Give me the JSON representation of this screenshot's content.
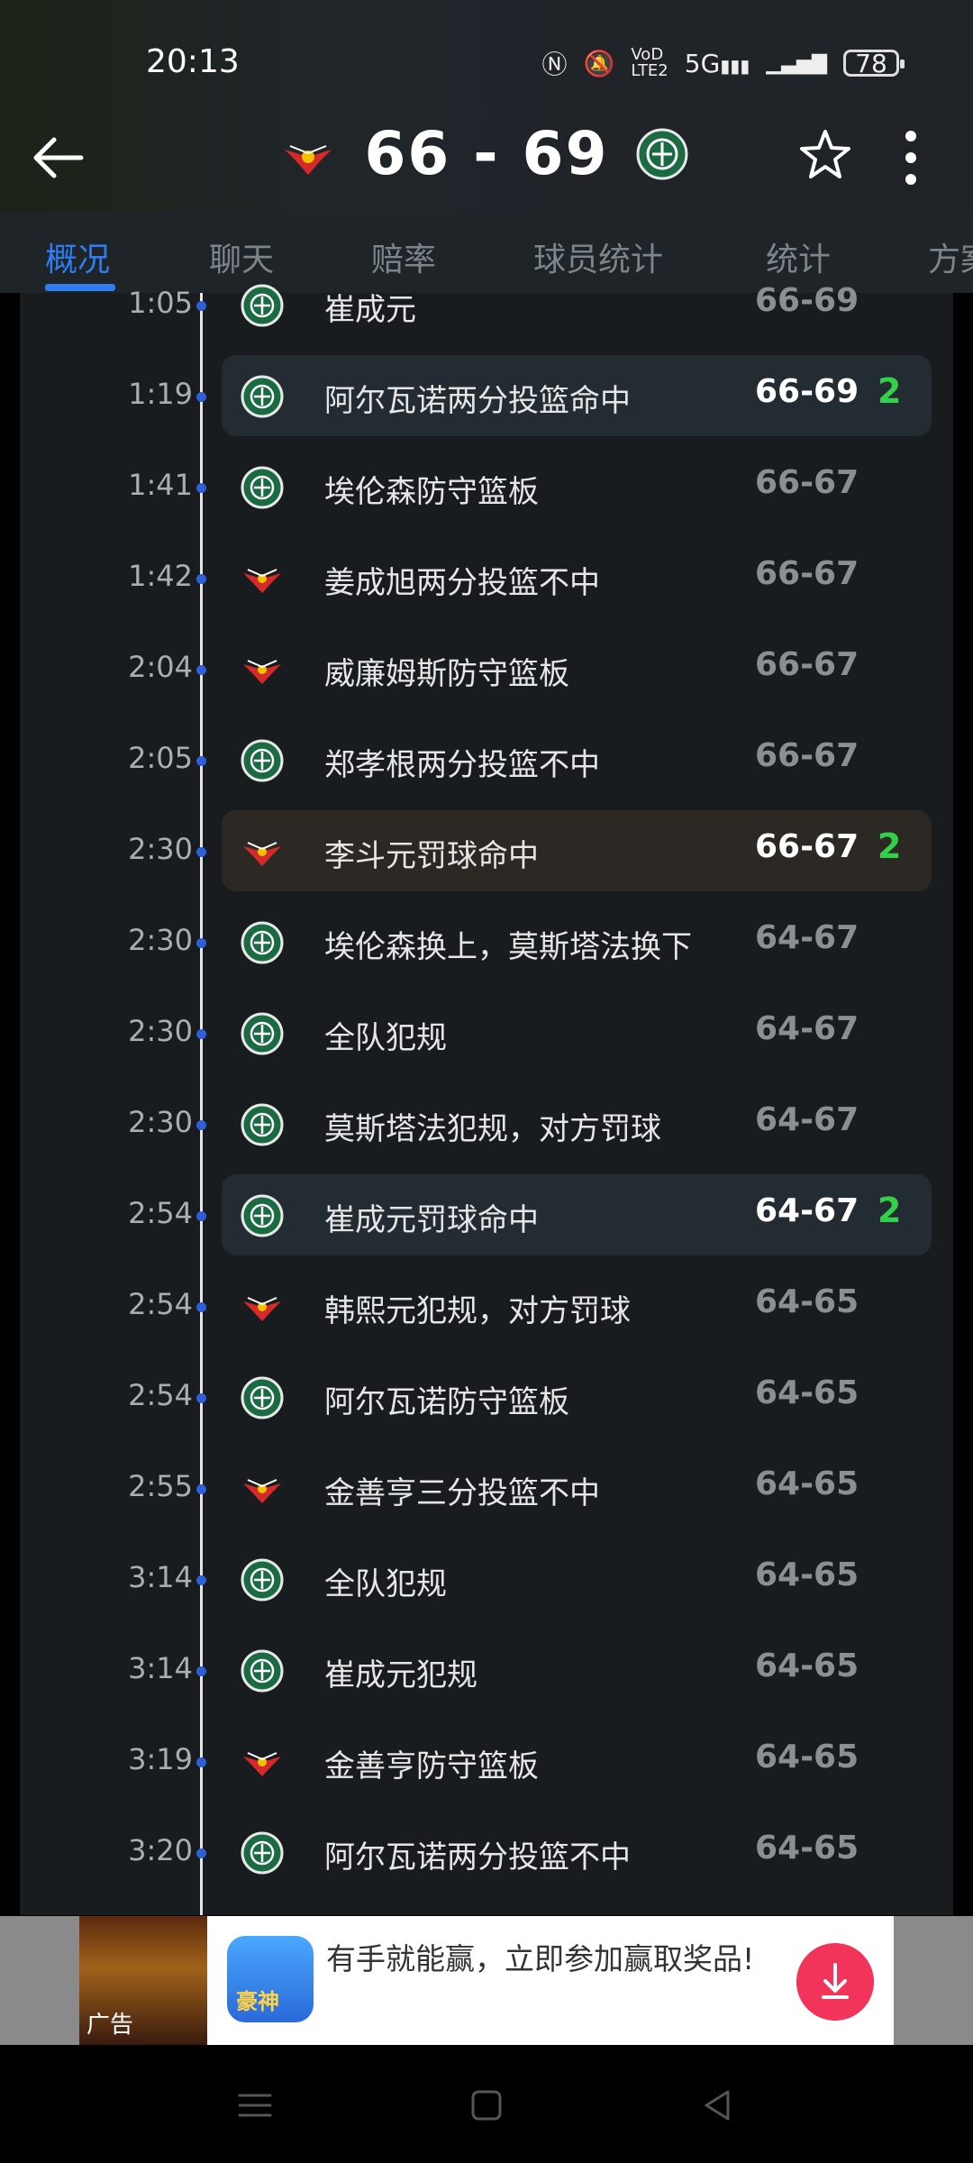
{
  "status_bar": {
    "time": "20:13",
    "battery": "78",
    "network": "5G"
  },
  "header": {
    "score": "66 - 69",
    "home_logo": "red-bird-logo",
    "away_logo": "green-crest-logo"
  },
  "tabs": [
    "概况",
    "聊天",
    "赔率",
    "球员统计",
    "统计",
    "方案"
  ],
  "feed": [
    {
      "time": "1:05",
      "team": "away",
      "desc": "崔成元",
      "score": "66-69",
      "points": "",
      "highlight": ""
    },
    {
      "time": "1:19",
      "team": "away",
      "desc": "阿尔瓦诺两分投篮命中",
      "score": "66-69",
      "points": "2",
      "highlight": "blue"
    },
    {
      "time": "1:41",
      "team": "away",
      "desc": "埃伦森防守篮板",
      "score": "66-67",
      "points": "",
      "highlight": ""
    },
    {
      "time": "1:42",
      "team": "home",
      "desc": "姜成旭两分投篮不中",
      "score": "66-67",
      "points": "",
      "highlight": ""
    },
    {
      "time": "2:04",
      "team": "home",
      "desc": "威廉姆斯防守篮板",
      "score": "66-67",
      "points": "",
      "highlight": ""
    },
    {
      "time": "2:05",
      "team": "away",
      "desc": "郑孝根两分投篮不中",
      "score": "66-67",
      "points": "",
      "highlight": ""
    },
    {
      "time": "2:30",
      "team": "home",
      "desc": "李斗元罚球命中",
      "score": "66-67",
      "points": "2",
      "highlight": "brown"
    },
    {
      "time": "2:30",
      "team": "away",
      "desc": "埃伦森换上，莫斯塔法换下",
      "score": "64-67",
      "points": "",
      "highlight": ""
    },
    {
      "time": "2:30",
      "team": "away",
      "desc": "全队犯规",
      "score": "64-67",
      "points": "",
      "highlight": ""
    },
    {
      "time": "2:30",
      "team": "away",
      "desc": "莫斯塔法犯规，对方罚球",
      "score": "64-67",
      "points": "",
      "highlight": ""
    },
    {
      "time": "2:54",
      "team": "away",
      "desc": "崔成元罚球命中",
      "score": "64-67",
      "points": "2",
      "highlight": "blue"
    },
    {
      "time": "2:54",
      "team": "home",
      "desc": "韩熙元犯规，对方罚球",
      "score": "64-65",
      "points": "",
      "highlight": ""
    },
    {
      "time": "2:54",
      "team": "away",
      "desc": "阿尔瓦诺防守篮板",
      "score": "64-65",
      "points": "",
      "highlight": ""
    },
    {
      "time": "2:55",
      "team": "home",
      "desc": "金善亨三分投篮不中",
      "score": "64-65",
      "points": "",
      "highlight": ""
    },
    {
      "time": "3:14",
      "team": "away",
      "desc": "全队犯规",
      "score": "64-65",
      "points": "",
      "highlight": ""
    },
    {
      "time": "3:14",
      "team": "away",
      "desc": "崔成元犯规",
      "score": "64-65",
      "points": "",
      "highlight": ""
    },
    {
      "time": "3:19",
      "team": "home",
      "desc": "金善亨防守篮板",
      "score": "64-65",
      "points": "",
      "highlight": ""
    },
    {
      "time": "3:20",
      "team": "away",
      "desc": "阿尔瓦诺两分投篮不中",
      "score": "64-65",
      "points": "",
      "highlight": ""
    }
  ],
  "ad": {
    "label": "广告",
    "app_icon_text": "豪神",
    "text": "有手就能赢，立即参加赢取奖品!"
  },
  "colors": {
    "accent": "#2f7df3",
    "points_green": "#34d04a",
    "highlight_blue": "#232c33",
    "highlight_brown": "#2c2824"
  }
}
